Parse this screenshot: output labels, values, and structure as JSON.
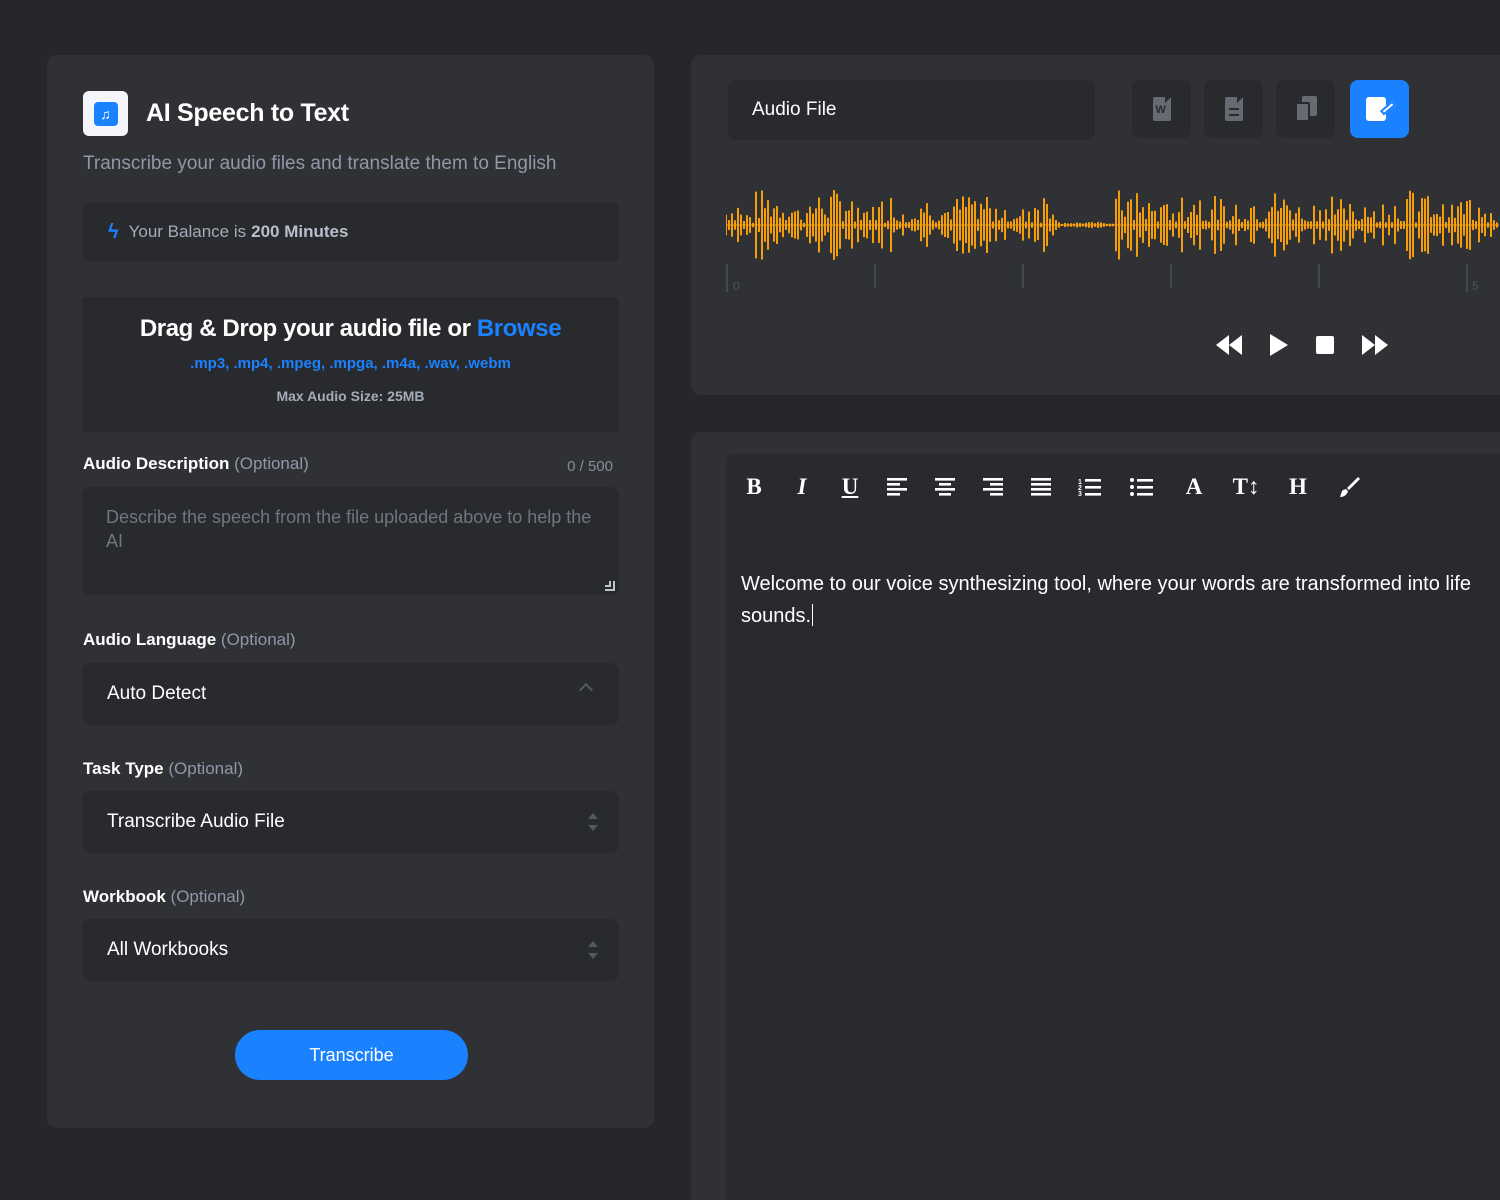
{
  "app": {
    "title": "AI Speech to Text",
    "subtitle": "Transcribe your audio files and translate them to English"
  },
  "balance": {
    "prefix": "Your Balance is",
    "value": "200 Minutes"
  },
  "dropzone": {
    "title": "Drag & Drop your audio file or",
    "browse_label": "Browse",
    "formats": ".mp3, .mp4, .mpeg, .mpga, .m4a, .wav, .webm",
    "max_size": "Max Audio Size: 25MB"
  },
  "fields": {
    "description": {
      "label": "Audio Description",
      "optional": "(Optional)",
      "counter": "0 / 500",
      "placeholder": "Describe the speech from the file uploaded above to help the AI"
    },
    "language": {
      "label": "Audio Language",
      "optional": "(Optional)",
      "value": "Auto Detect"
    },
    "task_type": {
      "label": "Task Type",
      "optional": "(Optional)",
      "value": "Transcribe Audio File"
    },
    "workbook": {
      "label": "Workbook",
      "optional": "(Optional)",
      "value": "All Workbooks"
    }
  },
  "transcribe_button": "Transcribe",
  "player": {
    "file_label": "Audio File",
    "toolbar_icons": [
      "word-doc-icon",
      "text-doc-icon",
      "copy-icon",
      "edit-doc-icon"
    ],
    "timeline_labels": [
      "0",
      "5"
    ],
    "controls": [
      "rewind-icon",
      "play-icon",
      "stop-icon",
      "fast-forward-icon"
    ]
  },
  "editor": {
    "toolbar": [
      "bold-icon",
      "italic-icon",
      "underline-icon",
      "align-left-icon",
      "align-center-icon",
      "align-right-icon",
      "align-justify-icon",
      "ordered-list-icon",
      "unordered-list-icon",
      "font-color-icon",
      "font-size-icon",
      "heading-icon",
      "brush-icon"
    ],
    "bold_glyph": "B",
    "italic_glyph": "I",
    "underline_glyph": "U",
    "font_glyph": "A",
    "size_glyph": "T↕",
    "heading_glyph": "H",
    "content": "Welcome to our voice synthesizing tool, where your words are transformed into life sounds."
  },
  "colors": {
    "accent": "#1a82ff",
    "waveform": "#f59e0b",
    "panel": "#303135",
    "field": "#292a2e",
    "background": "#26272b"
  }
}
